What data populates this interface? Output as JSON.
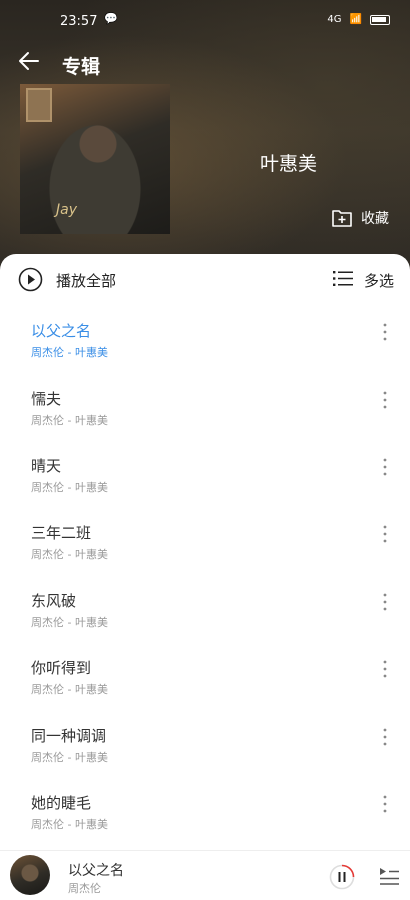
{
  "status": {
    "time": "23:57",
    "notification": "微信",
    "signal": "4G"
  },
  "header": {
    "title": "专辑"
  },
  "album": {
    "cover_logo": "Jay",
    "artist": "叶惠美",
    "collect_label": "收藏"
  },
  "toolbar": {
    "play_all_label": "播放全部",
    "multi_select_label": "多选"
  },
  "songs": [
    {
      "title": "以父之名",
      "subtitle": "周杰伦 - 叶惠美",
      "active": true
    },
    {
      "title": "懦夫",
      "subtitle": "周杰伦 - 叶惠美"
    },
    {
      "title": "晴天",
      "subtitle": "周杰伦 - 叶惠美"
    },
    {
      "title": "三年二班",
      "subtitle": "周杰伦 - 叶惠美"
    },
    {
      "title": "东风破",
      "subtitle": "周杰伦 - 叶惠美"
    },
    {
      "title": "你听得到",
      "subtitle": "周杰伦 - 叶惠美"
    },
    {
      "title": "同一种调调",
      "subtitle": "周杰伦 - 叶惠美"
    },
    {
      "title": "她的睫毛",
      "subtitle": "周杰伦 - 叶惠美"
    }
  ],
  "now_playing": {
    "title": "以父之名",
    "artist": "周杰伦",
    "state": "playing"
  },
  "colors": {
    "accent": "#3a8ee6",
    "pause_ring": "#e53935"
  }
}
